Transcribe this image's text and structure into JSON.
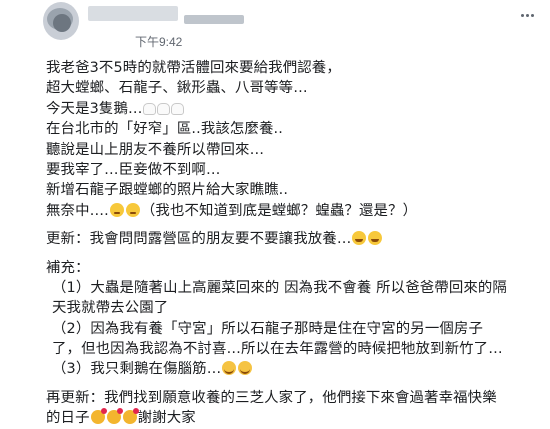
{
  "post": {
    "timestamp": "下午9:42",
    "lines": [
      "我老爸3不5時的就帶活體回來要給我們認養，",
      "超大螳螂、石龍子、鍬形蟲、八哥等等…",
      "今天是3隻鵝…",
      "在台北市的「好窄」區..我該怎麼養..",
      "聽說是山上朋友不養所以帶回來…",
      "要我宰了…臣妾做不到啊…",
      "新增石龍子跟螳螂的照片給大家瞧瞧..",
      "無奈中….",
      "（我也不知道到底是螳螂？蝗蟲？還是？）"
    ],
    "update1": "更新：我會問問露營區的朋友要不要讓我放養…",
    "supplement_title": "補充：",
    "supplement": [
      "（1）大蟲是隨著山上高麗菜回來的 因為我不會養 所以爸爸帶回來的隔",
      "天我就帶去公園了",
      "（2）因為我有養「守宮」所以石龍子那時是住在守宮的另一個房子",
      "了，但也因為我認為不討喜…所以在去年露營的時候把牠放到新竹了…",
      "（3）我只剩鵝在傷腦筋…"
    ],
    "update2_line1": "再更新：我們找到願意收養的三芝人家了，他們接下來會過著幸福快樂",
    "update2_line2": "的日子",
    "update2_thanks": "謝謝大家",
    "icons": {
      "more": "more-dots-icon",
      "hands": "palms-up-icon",
      "sad": "downcast-face-icon",
      "grin": "grinning-face-icon",
      "hug": "smiling-face-icon",
      "love": "smiling-face-with-hearts-icon"
    }
  }
}
